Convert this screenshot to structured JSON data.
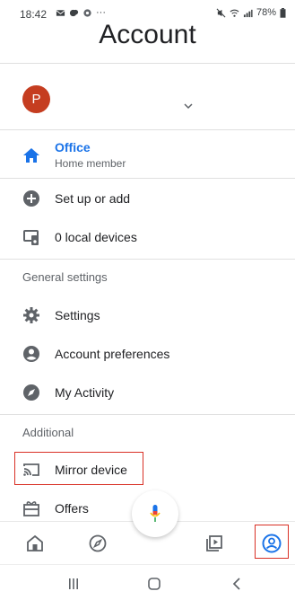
{
  "status_bar": {
    "time": "18:42",
    "more": "···",
    "battery": "78%"
  },
  "header": {
    "title": "Account"
  },
  "account": {
    "avatar_letter": "P"
  },
  "home": {
    "name": "Office",
    "role": "Home member"
  },
  "menu": {
    "setup": "Set up or add",
    "local_devices": "0 local devices",
    "general_section": "General settings",
    "settings": "Settings",
    "account_preferences": "Account preferences",
    "my_activity": "My Activity",
    "additional_section": "Additional",
    "mirror_device": "Mirror device",
    "offers": "Offers"
  },
  "icons": {
    "home": "home-icon",
    "plus": "add-circle-icon",
    "devices": "local-devices-icon",
    "settings": "gear-icon",
    "account": "account-circle-icon",
    "activity": "compass-icon",
    "cast": "cast-icon",
    "offers": "gift-icon",
    "mic": "mic-icon",
    "nav_home": "nav-home-icon",
    "nav_discover": "nav-discover-icon",
    "nav_media": "nav-media-icon",
    "nav_account": "nav-account-icon"
  },
  "colors": {
    "accent": "#1a73e8",
    "avatar": "#c53d20",
    "highlight": "#d93025"
  }
}
